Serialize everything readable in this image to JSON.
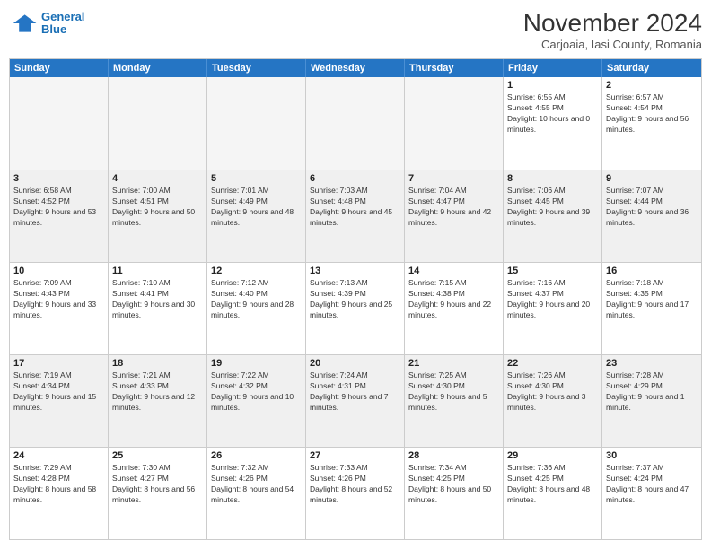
{
  "header": {
    "logo_line1": "General",
    "logo_line2": "Blue",
    "month_title": "November 2024",
    "location": "Carjoaia, Iasi County, Romania"
  },
  "weekdays": [
    "Sunday",
    "Monday",
    "Tuesday",
    "Wednesday",
    "Thursday",
    "Friday",
    "Saturday"
  ],
  "weeks": [
    [
      {
        "day": "",
        "empty": true
      },
      {
        "day": "",
        "empty": true
      },
      {
        "day": "",
        "empty": true
      },
      {
        "day": "",
        "empty": true
      },
      {
        "day": "",
        "empty": true
      },
      {
        "day": "1",
        "sunrise": "6:55 AM",
        "sunset": "4:55 PM",
        "daylight": "10 hours and 0 minutes."
      },
      {
        "day": "2",
        "sunrise": "6:57 AM",
        "sunset": "4:54 PM",
        "daylight": "9 hours and 56 minutes."
      }
    ],
    [
      {
        "day": "3",
        "sunrise": "6:58 AM",
        "sunset": "4:52 PM",
        "daylight": "9 hours and 53 minutes."
      },
      {
        "day": "4",
        "sunrise": "7:00 AM",
        "sunset": "4:51 PM",
        "daylight": "9 hours and 50 minutes."
      },
      {
        "day": "5",
        "sunrise": "7:01 AM",
        "sunset": "4:49 PM",
        "daylight": "9 hours and 48 minutes."
      },
      {
        "day": "6",
        "sunrise": "7:03 AM",
        "sunset": "4:48 PM",
        "daylight": "9 hours and 45 minutes."
      },
      {
        "day": "7",
        "sunrise": "7:04 AM",
        "sunset": "4:47 PM",
        "daylight": "9 hours and 42 minutes."
      },
      {
        "day": "8",
        "sunrise": "7:06 AM",
        "sunset": "4:45 PM",
        "daylight": "9 hours and 39 minutes."
      },
      {
        "day": "9",
        "sunrise": "7:07 AM",
        "sunset": "4:44 PM",
        "daylight": "9 hours and 36 minutes."
      }
    ],
    [
      {
        "day": "10",
        "sunrise": "7:09 AM",
        "sunset": "4:43 PM",
        "daylight": "9 hours and 33 minutes."
      },
      {
        "day": "11",
        "sunrise": "7:10 AM",
        "sunset": "4:41 PM",
        "daylight": "9 hours and 30 minutes."
      },
      {
        "day": "12",
        "sunrise": "7:12 AM",
        "sunset": "4:40 PM",
        "daylight": "9 hours and 28 minutes."
      },
      {
        "day": "13",
        "sunrise": "7:13 AM",
        "sunset": "4:39 PM",
        "daylight": "9 hours and 25 minutes."
      },
      {
        "day": "14",
        "sunrise": "7:15 AM",
        "sunset": "4:38 PM",
        "daylight": "9 hours and 22 minutes."
      },
      {
        "day": "15",
        "sunrise": "7:16 AM",
        "sunset": "4:37 PM",
        "daylight": "9 hours and 20 minutes."
      },
      {
        "day": "16",
        "sunrise": "7:18 AM",
        "sunset": "4:35 PM",
        "daylight": "9 hours and 17 minutes."
      }
    ],
    [
      {
        "day": "17",
        "sunrise": "7:19 AM",
        "sunset": "4:34 PM",
        "daylight": "9 hours and 15 minutes."
      },
      {
        "day": "18",
        "sunrise": "7:21 AM",
        "sunset": "4:33 PM",
        "daylight": "9 hours and 12 minutes."
      },
      {
        "day": "19",
        "sunrise": "7:22 AM",
        "sunset": "4:32 PM",
        "daylight": "9 hours and 10 minutes."
      },
      {
        "day": "20",
        "sunrise": "7:24 AM",
        "sunset": "4:31 PM",
        "daylight": "9 hours and 7 minutes."
      },
      {
        "day": "21",
        "sunrise": "7:25 AM",
        "sunset": "4:30 PM",
        "daylight": "9 hours and 5 minutes."
      },
      {
        "day": "22",
        "sunrise": "7:26 AM",
        "sunset": "4:30 PM",
        "daylight": "9 hours and 3 minutes."
      },
      {
        "day": "23",
        "sunrise": "7:28 AM",
        "sunset": "4:29 PM",
        "daylight": "9 hours and 1 minute."
      }
    ],
    [
      {
        "day": "24",
        "sunrise": "7:29 AM",
        "sunset": "4:28 PM",
        "daylight": "8 hours and 58 minutes."
      },
      {
        "day": "25",
        "sunrise": "7:30 AM",
        "sunset": "4:27 PM",
        "daylight": "8 hours and 56 minutes."
      },
      {
        "day": "26",
        "sunrise": "7:32 AM",
        "sunset": "4:26 PM",
        "daylight": "8 hours and 54 minutes."
      },
      {
        "day": "27",
        "sunrise": "7:33 AM",
        "sunset": "4:26 PM",
        "daylight": "8 hours and 52 minutes."
      },
      {
        "day": "28",
        "sunrise": "7:34 AM",
        "sunset": "4:25 PM",
        "daylight": "8 hours and 50 minutes."
      },
      {
        "day": "29",
        "sunrise": "7:36 AM",
        "sunset": "4:25 PM",
        "daylight": "8 hours and 48 minutes."
      },
      {
        "day": "30",
        "sunrise": "7:37 AM",
        "sunset": "4:24 PM",
        "daylight": "8 hours and 47 minutes."
      }
    ]
  ]
}
